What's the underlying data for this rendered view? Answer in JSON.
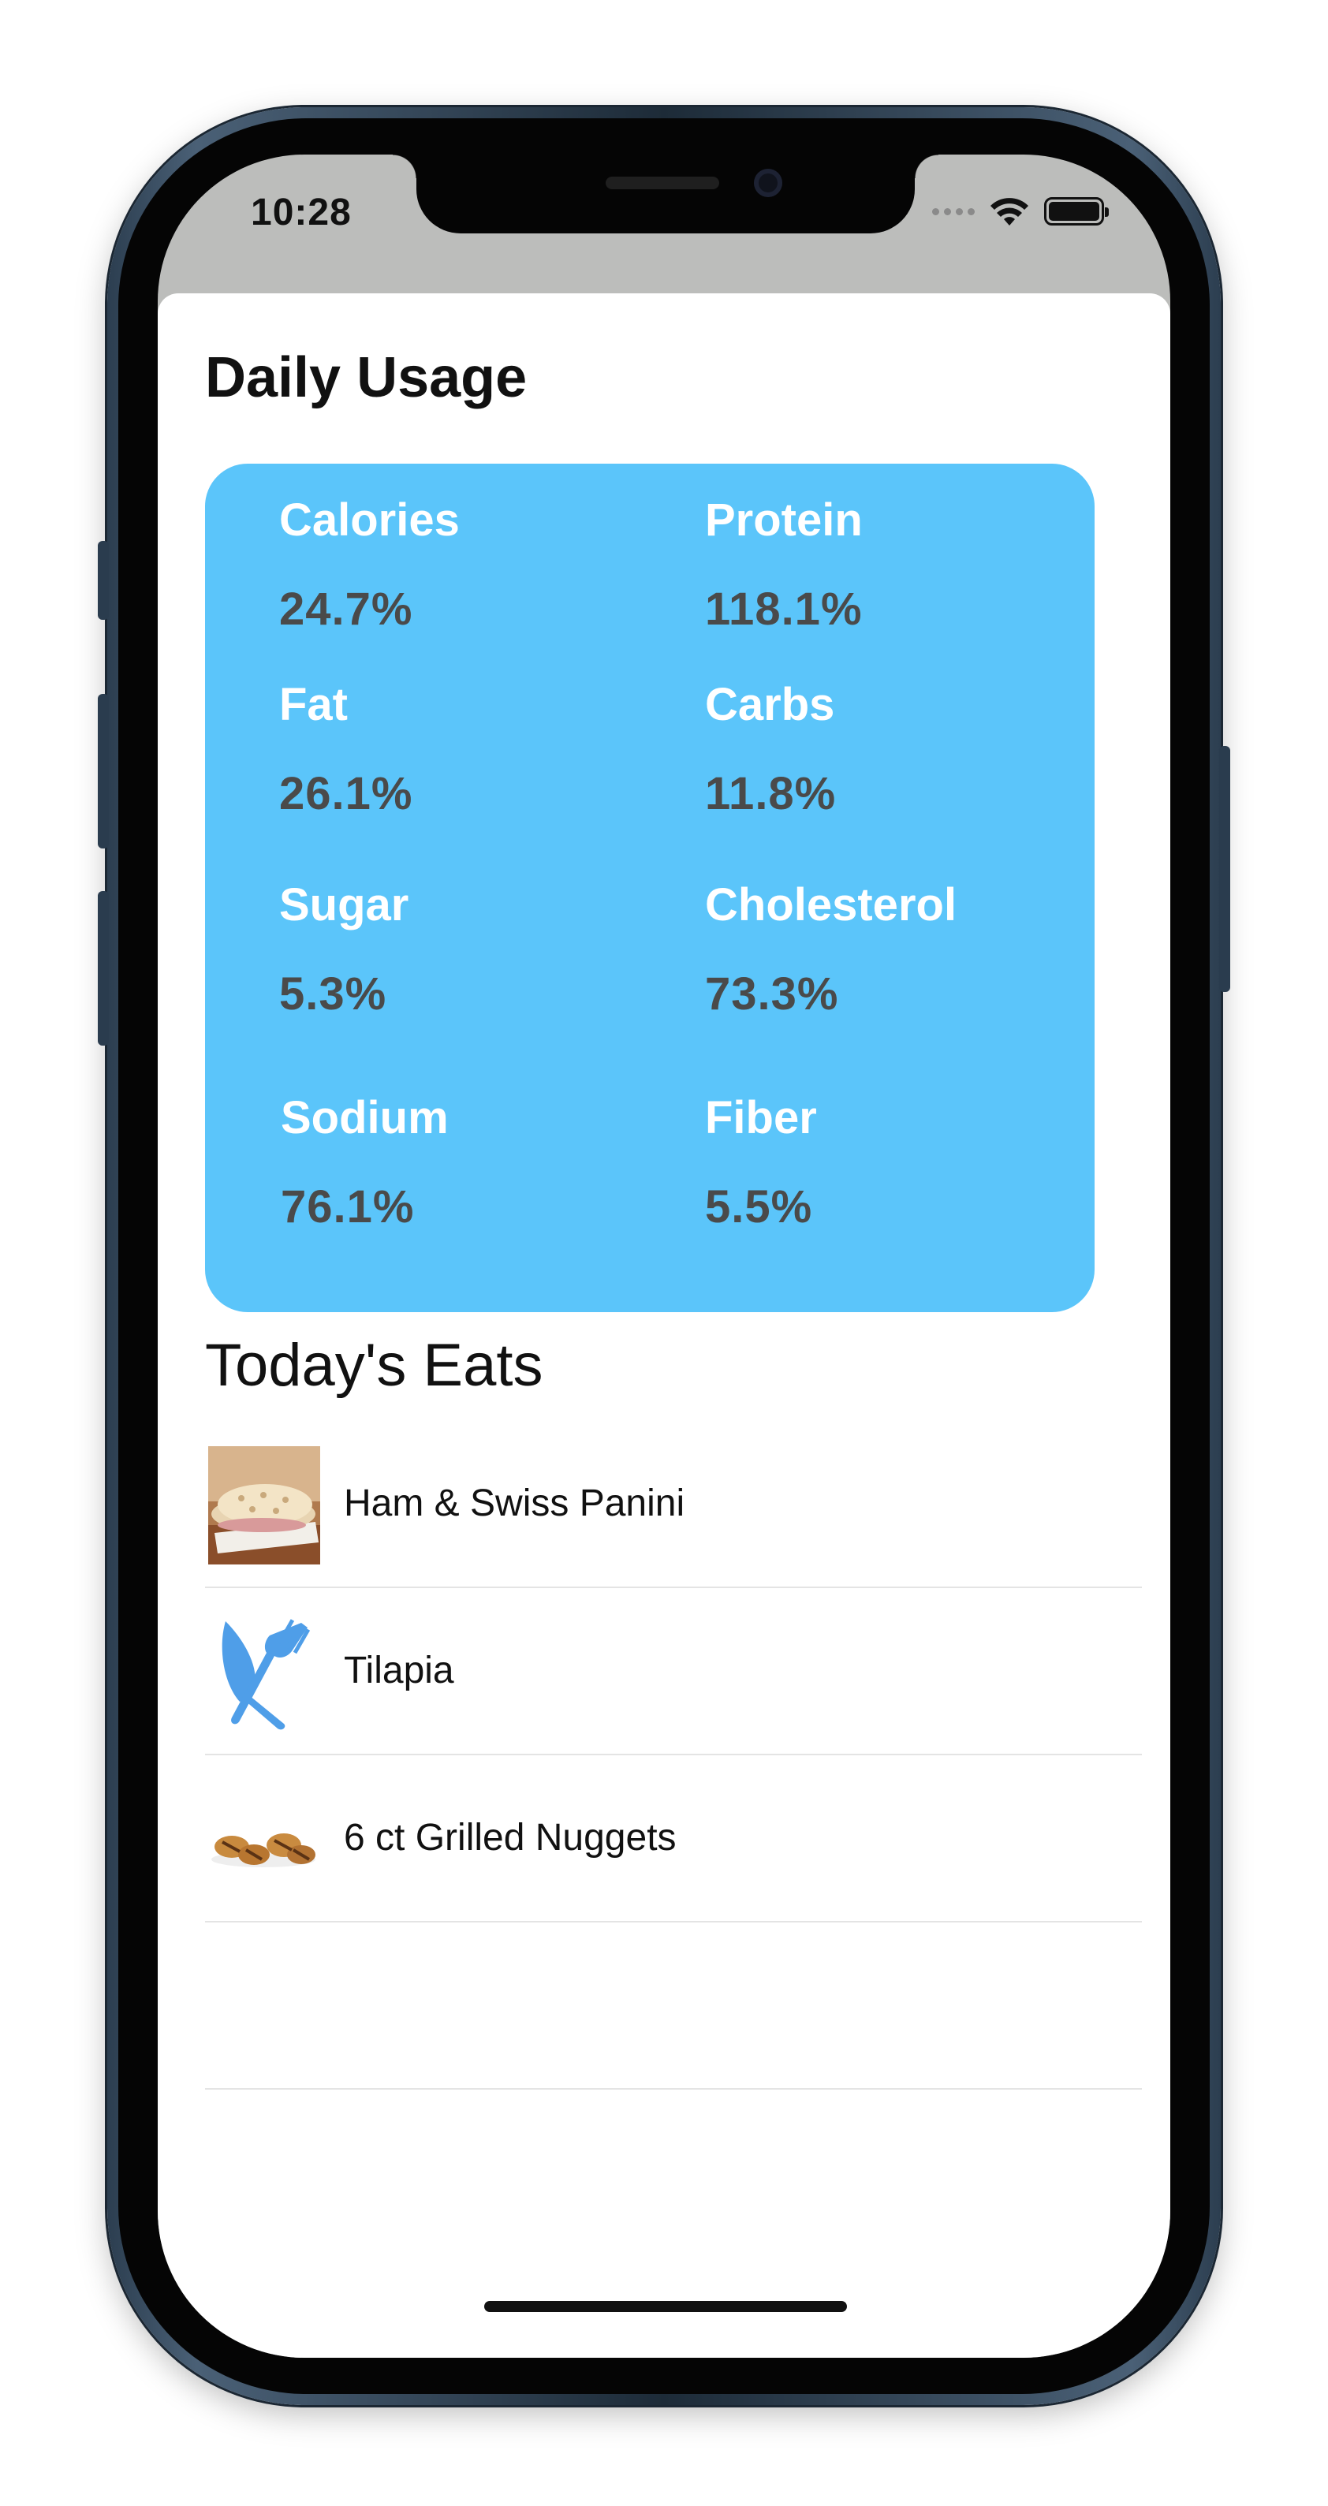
{
  "status_bar": {
    "time": "10:28"
  },
  "page": {
    "title": "Daily Usage"
  },
  "daily_usage": {
    "items": [
      {
        "label": "Calories",
        "value": "24.7%"
      },
      {
        "label": "Protein",
        "value": "118.1%"
      },
      {
        "label": "Fat",
        "value": "26.1%"
      },
      {
        "label": "Carbs",
        "value": "11.8%"
      },
      {
        "label": "Sugar",
        "value": "5.3%"
      },
      {
        "label": "Cholesterol",
        "value": "73.3%"
      },
      {
        "label": "Sodium",
        "value": "76.1%"
      },
      {
        "label": "Fiber",
        "value": "5.5%"
      }
    ]
  },
  "eats": {
    "title": "Today's Eats",
    "items": [
      {
        "name": "Ham & Swiss Panini",
        "icon": "panini-photo"
      },
      {
        "name": "Tilapia",
        "icon": "fork-knife-icon"
      },
      {
        "name": "6 ct Grilled Nuggets",
        "icon": "nuggets-photo"
      },
      {
        "name": "",
        "icon": ""
      }
    ]
  },
  "colors": {
    "card_background": "#5bc5fa",
    "label_text": "#ffffff",
    "value_text": "#4a4a4a",
    "icon_blue": "#4f9ee8"
  }
}
